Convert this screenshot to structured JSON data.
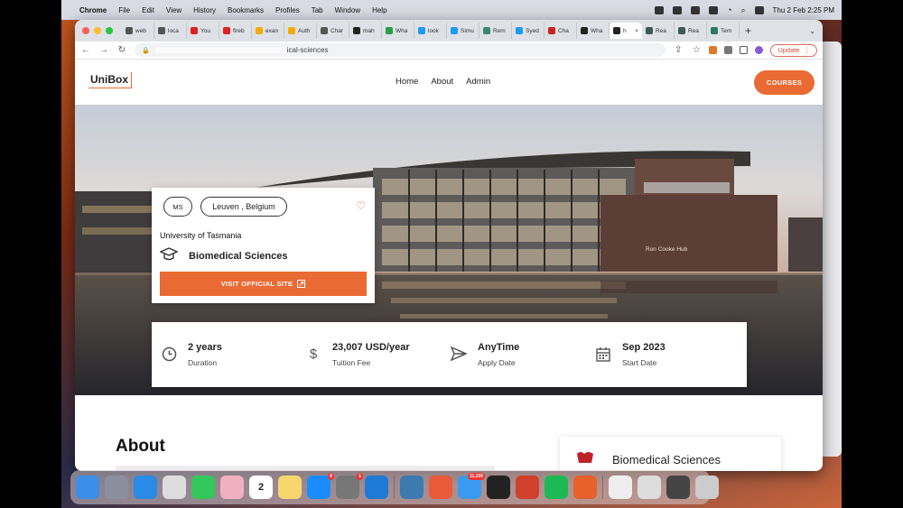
{
  "menubar": {
    "app": "Chrome",
    "items": [
      "File",
      "Edit",
      "View",
      "History",
      "Bookmarks",
      "Profiles",
      "Tab",
      "Window",
      "Help"
    ],
    "clock": "Thu 2 Feb  2:25 PM"
  },
  "browser": {
    "tabs": [
      {
        "label": "web",
        "color": "#555"
      },
      {
        "label": "loca",
        "color": "#555"
      },
      {
        "label": "You",
        "color": "#e02020"
      },
      {
        "label": "fireb",
        "color": "#e02020"
      },
      {
        "label": "exan",
        "color": "#f2a900"
      },
      {
        "label": "Auth",
        "color": "#f2a900"
      },
      {
        "label": "Char",
        "color": "#555"
      },
      {
        "label": "mah",
        "color": "#222"
      },
      {
        "label": "Wha",
        "color": "#25a244"
      },
      {
        "label": "look",
        "color": "#1d9bf0"
      },
      {
        "label": "Simu",
        "color": "#1d9bf0"
      },
      {
        "label": "Rem",
        "color": "#3a8a6a"
      },
      {
        "label": "Syed",
        "color": "#1d9bf0"
      },
      {
        "label": "Cha",
        "color": "#d02020"
      },
      {
        "label": "Wha",
        "color": "#222"
      },
      {
        "label": "h",
        "color": "#222"
      },
      {
        "label": "Rea",
        "color": "#3a5a5a"
      },
      {
        "label": "Rea",
        "color": "#3a5a5a"
      },
      {
        "label": "Tem",
        "color": "#2a7a5a"
      }
    ],
    "active_tab_index": 15,
    "url_suffix": "ical-sciences",
    "update_label": "Update"
  },
  "site": {
    "logo": "UniBox",
    "nav": [
      "Home",
      "About",
      "Admin"
    ],
    "cta": "COURSES",
    "accent": "#ea6a33",
    "card": {
      "degree": "MS",
      "location": "Leuven , Belgium",
      "university": "University of Tasmania",
      "program": "Biomedical Sciences",
      "visit_label": "VISIT OFFICIAL SITE"
    },
    "building_sign": "Ron Cooke Hub",
    "stats": [
      {
        "icon": "clock-icon",
        "value": "2 years",
        "label": "Duration"
      },
      {
        "icon": "dollar-icon",
        "value": "23,007 USD/year",
        "label": "Tuition Fee"
      },
      {
        "icon": "send-icon",
        "value": "AnyTime",
        "label": "Apply Date"
      },
      {
        "icon": "calendar-icon",
        "value": "Sep 2023",
        "label": "Start Date"
      }
    ],
    "about_heading": "About",
    "side_card_title": "Biomedical Sciences"
  },
  "dock": {
    "apps": [
      {
        "name": "finder",
        "color": "#3b8fe8"
      },
      {
        "name": "launchpad",
        "color": "#8a8fa0"
      },
      {
        "name": "safari",
        "color": "#2a8ae8"
      },
      {
        "name": "chrome",
        "color": "#dddddd"
      },
      {
        "name": "messages",
        "color": "#34c759"
      },
      {
        "name": "photos",
        "color": "#f0b0c0"
      },
      {
        "name": "calendar",
        "color": "#ffffff",
        "text": "2"
      },
      {
        "name": "notes",
        "color": "#f5d76e"
      },
      {
        "name": "app-store",
        "color": "#1a8cff",
        "badge": "6"
      },
      {
        "name": "system-settings",
        "color": "#777777",
        "badge": "1"
      },
      {
        "name": "vscode",
        "color": "#1f7ad6"
      },
      {
        "name": "sep"
      },
      {
        "name": "browser",
        "color": "#3d7ab0"
      },
      {
        "name": "pen",
        "color": "#ea5a3a"
      },
      {
        "name": "mail",
        "color": "#3a9aee",
        "badge": "11,196"
      },
      {
        "name": "terminal",
        "color": "#222222"
      },
      {
        "name": "office",
        "color": "#d0402a"
      },
      {
        "name": "spotify",
        "color": "#1db954"
      },
      {
        "name": "firefox",
        "color": "#e8602a"
      },
      {
        "name": "sep"
      },
      {
        "name": "doc",
        "color": "#eeeeee"
      },
      {
        "name": "preview",
        "color": "#dddddd"
      },
      {
        "name": "screen",
        "color": "#444444"
      },
      {
        "name": "trash",
        "color": "#cccccc"
      }
    ]
  }
}
